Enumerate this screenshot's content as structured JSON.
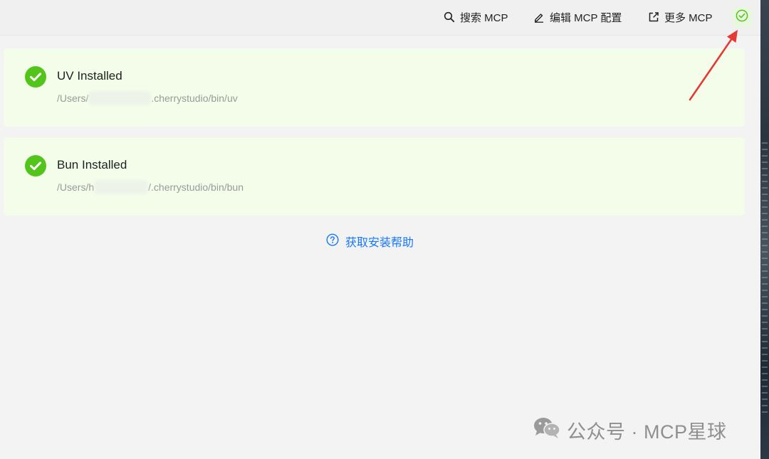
{
  "toolbar": {
    "search_label": "搜索 MCP",
    "edit_label": "编辑 MCP 配置",
    "more_label": "更多 MCP",
    "search_icon": "search-icon",
    "edit_icon": "pencil-icon",
    "more_icon": "external-link-icon",
    "status_icon": "check-circle-icon"
  },
  "cards": [
    {
      "title": "UV Installed",
      "path_prefix": "/Users/",
      "path_suffix": ".cherrystudio/bin/uv",
      "icon": "check-circle-icon"
    },
    {
      "title": "Bun Installed",
      "path_prefix": "/Users/h",
      "path_suffix": "/.cherrystudio/bin/bun",
      "icon": "check-circle-icon"
    }
  ],
  "help": {
    "label": "获取安装帮助",
    "icon": "question-circle-icon"
  },
  "watermark": {
    "text": "公众号 · MCP星球",
    "icon": "wechat-icon"
  },
  "colors": {
    "accent": "#1677ff",
    "success": "#52c41a",
    "card_bg": "#f3fde9",
    "annotation": "#e53935"
  }
}
